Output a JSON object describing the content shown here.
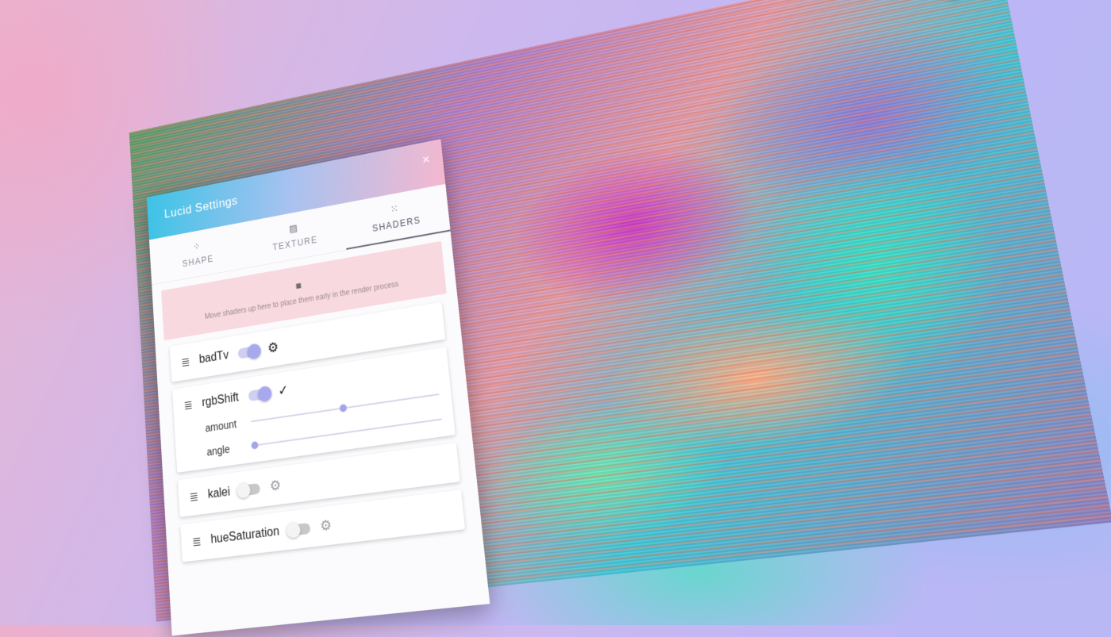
{
  "panel": {
    "title": "Lucid Settings",
    "close": "×"
  },
  "tabs": [
    {
      "label": "SHAPE",
      "icon": "shape-icon",
      "glyph": "⁘"
    },
    {
      "label": "TEXTURE",
      "icon": "texture-icon",
      "glyph": "▨"
    },
    {
      "label": "SHADERS",
      "icon": "shaders-icon",
      "glyph": "⁙"
    }
  ],
  "active_tab": "SHADERS",
  "dropzone": {
    "icon": "camera-icon",
    "glyph": "■",
    "text": "Move shaders up here to place them early in the render process"
  },
  "shaders": [
    {
      "name": "badTv",
      "enabled": true,
      "gear": "⚙"
    },
    {
      "name": "rgbShift",
      "enabled": true,
      "check": "✓",
      "params": [
        {
          "label": "amount",
          "value": 0.5
        },
        {
          "label": "angle",
          "value": 0.0
        }
      ]
    },
    {
      "name": "kalei",
      "enabled": false,
      "gear": "⚙"
    },
    {
      "name": "hueSaturation",
      "enabled": false,
      "gear": "⚙"
    }
  ],
  "drag_glyph": "≣",
  "corner_button": {
    "icon": "collapse-icon",
    "glyph": "⤡"
  },
  "colors": {
    "accent": "#a8a8ee",
    "header_start": "#3cc3e6",
    "header_end": "#f4b8cf",
    "dropzone": "#f9d9e0"
  }
}
